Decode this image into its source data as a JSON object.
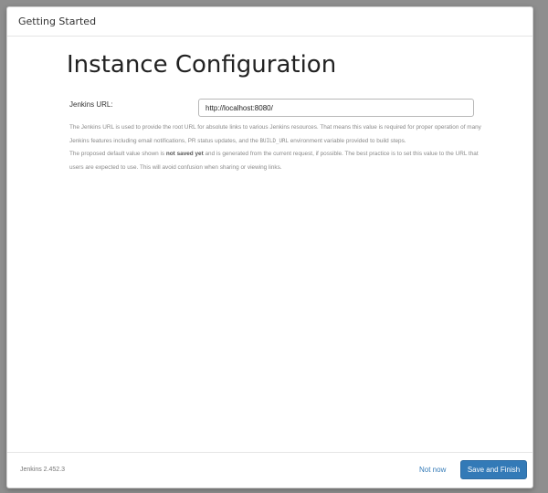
{
  "header": {
    "title": "Getting Started"
  },
  "main": {
    "title": "Instance Configuration",
    "url_label": "Jenkins URL:",
    "url_value": "http://localhost:8080/",
    "help": {
      "p1_a": "The Jenkins URL is used to provide the root URL for absolute links to various Jenkins resources. That means this value is required for proper operation of many Jenkins features including email notifications, PR status updates, and the ",
      "p1_code": "BUILD_URL",
      "p1_b": " environment variable provided to build steps.",
      "p2_a": "The proposed default value shown is ",
      "p2_bold": "not saved yet",
      "p2_b": " and is generated from the current request, if possible. The best practice is to set this value to the URL that users are expected to use. This will avoid confusion when sharing or viewing links."
    }
  },
  "footer": {
    "version": "Jenkins 2.452.3",
    "not_now": "Not now",
    "save_finish": "Save and Finish"
  },
  "colors": {
    "primary": "#337ab7",
    "backdrop": "#8e8e8e"
  }
}
